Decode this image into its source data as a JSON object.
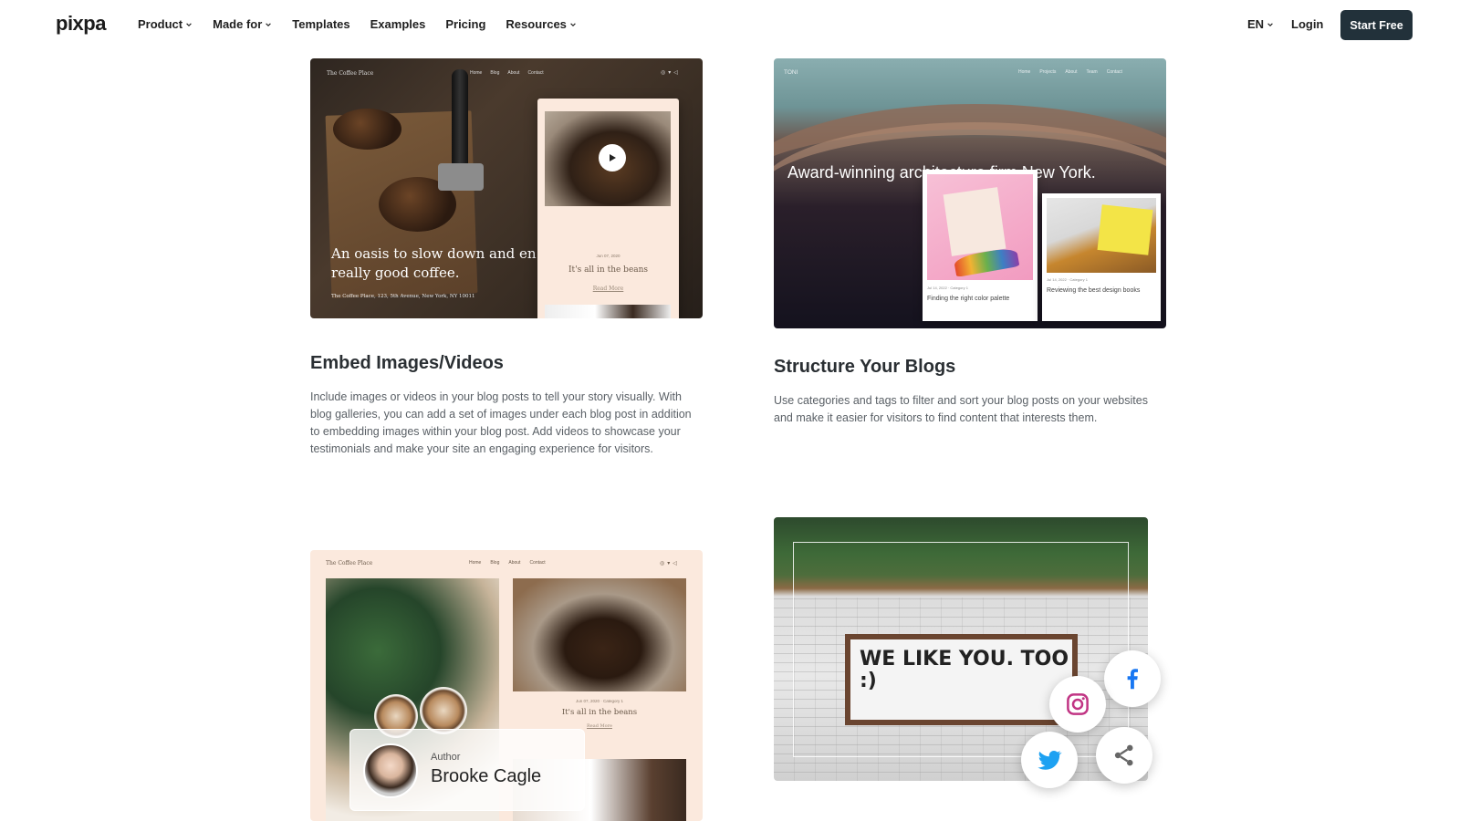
{
  "nav": {
    "logo": "pixpa",
    "menu": [
      {
        "label": "Product",
        "has_dropdown": true
      },
      {
        "label": "Made for",
        "has_dropdown": true
      },
      {
        "label": "Templates",
        "has_dropdown": false
      },
      {
        "label": "Examples",
        "has_dropdown": false
      },
      {
        "label": "Pricing",
        "has_dropdown": false
      },
      {
        "label": "Resources",
        "has_dropdown": true
      }
    ],
    "language": "EN",
    "login": "Login",
    "cta": "Start Free",
    "cta_color": "#22313a"
  },
  "features": [
    {
      "title": "Embed Images/Videos",
      "body": "Include images or videos in your blog posts to tell your story visually. With blog galleries, you can add a set of images under each blog post in addition to embedding images within your blog post. Add videos to showcase your testimonials and make your site an engaging experience for visitors.",
      "preview": {
        "brand": "The Coffee Place",
        "links": [
          "Home",
          "Blog",
          "About",
          "Contact"
        ],
        "hero": "An oasis to slow down and en really good coffee.",
        "address": "The Coffee Place, 123, 5th Avenue, New York, NY 10011",
        "post_date": "Jun 07, 2020",
        "post_title": "It's all in the beans",
        "post_link": "Read More"
      }
    },
    {
      "title": "Structure Your Blogs",
      "body": "Use categories and tags to filter and sort your blog posts on your websites and make it easier for visitors to find content that interests them.",
      "preview": {
        "brand": "TONI",
        "links": [
          "Home",
          "Projects",
          "About",
          "Team",
          "Contact"
        ],
        "hero": "Award-winning architecture firm New York.",
        "post1_meta": "Jul 14, 2022 · Category 1",
        "post1_title": "Finding the right color palette",
        "post2_meta": "Jul 14, 2022 · Category 1",
        "post2_title": "Reviewing the best design books"
      }
    }
  ],
  "blog_preview": {
    "brand": "The Coffee Place",
    "links": [
      "Home",
      "Blog",
      "About",
      "Contact"
    ],
    "post_date": "Jun 07, 2020 · Category 1",
    "post_title": "It's all in the beans",
    "post_link": "Read More",
    "author_label": "Author",
    "author_name": "Brooke Cagle"
  },
  "social_preview": {
    "sign_text": "WE LIKE YOU. TOO :)",
    "icons": [
      "facebook-icon",
      "instagram-icon",
      "twitter-icon",
      "share-icon"
    ],
    "colors": {
      "facebook": "#1877f2",
      "instagram": "#c13584",
      "twitter": "#1da1f2",
      "share": "#666666"
    }
  }
}
